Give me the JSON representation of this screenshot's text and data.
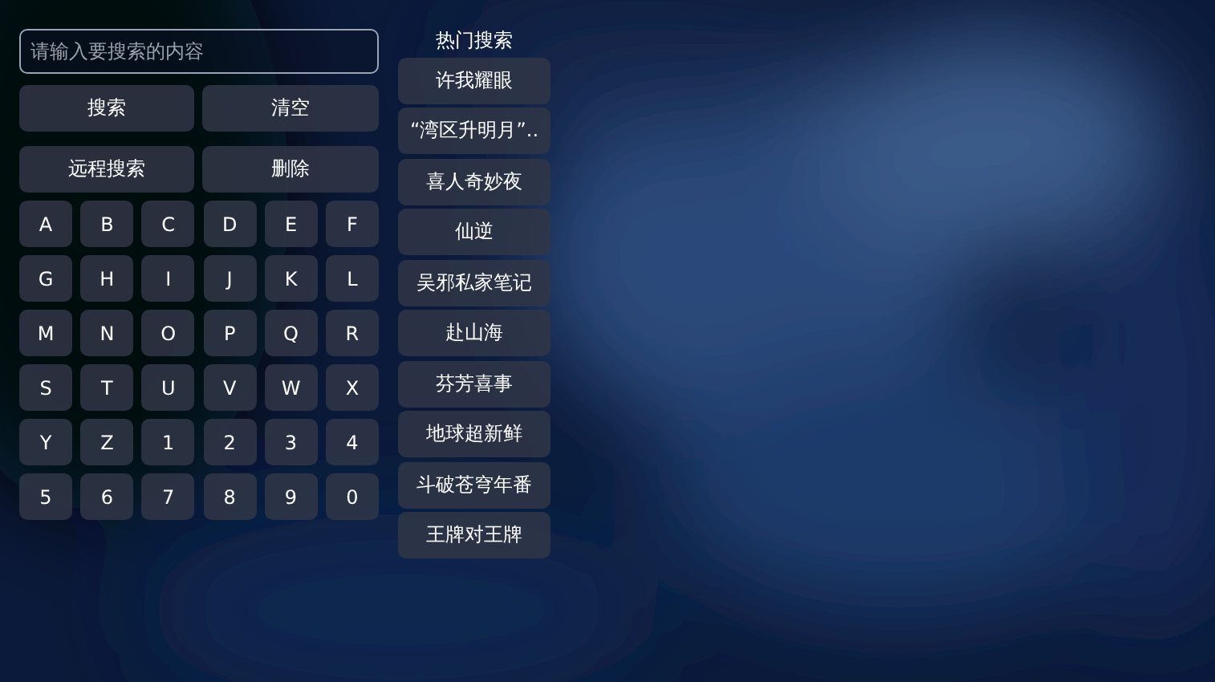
{
  "search_field": {
    "placeholder": "请输入要搜索的内容"
  },
  "actions": [
    "搜索",
    "清空",
    "远程搜索",
    "删除"
  ],
  "keys": [
    "A",
    "B",
    "C",
    "D",
    "E",
    "F",
    "G",
    "H",
    "I",
    "J",
    "K",
    "L",
    "M",
    "N",
    "O",
    "P",
    "Q",
    "R",
    "S",
    "T",
    "U",
    "V",
    "W",
    "X",
    "Y",
    "Z",
    "1",
    "2",
    "3",
    "4",
    "5",
    "6",
    "7",
    "8",
    "9",
    "0"
  ],
  "hot_search": {
    "title": "热门搜索",
    "items": [
      "许我耀眼",
      "“湾区升明月”..",
      "喜人奇妙夜",
      "仙逆",
      "吴邪私家笔记",
      "赴山海",
      "芬芳喜事",
      "地球超新鲜",
      "斗破苍穹年番",
      "王牌对王牌"
    ]
  }
}
